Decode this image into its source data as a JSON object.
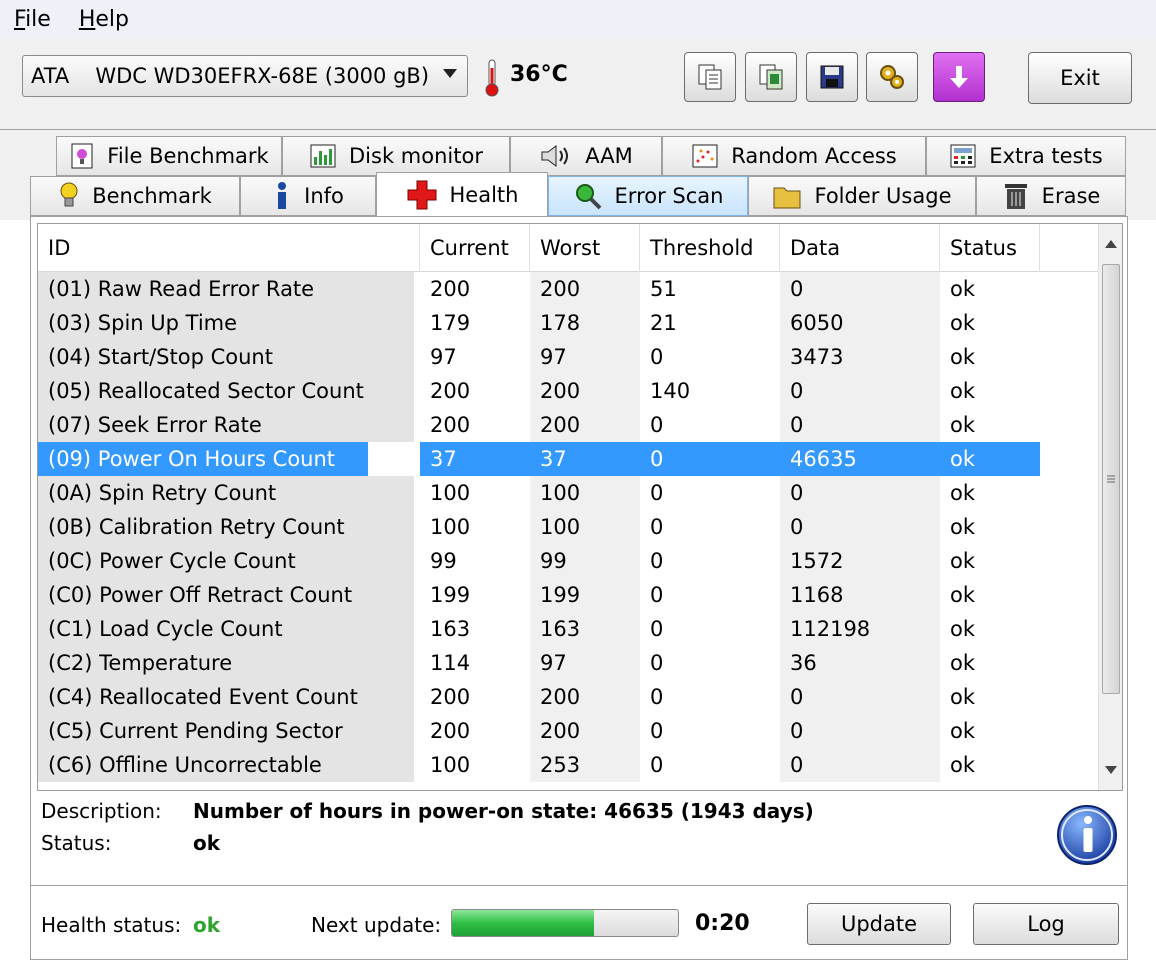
{
  "menu": {
    "file": "File",
    "file_key": "F",
    "file_rest": "ile",
    "help_key": "H",
    "help_rest": "elp"
  },
  "toolbar": {
    "drive_prefix": "ATA",
    "drive_name": "WDC WD30EFRX-68E (3000 gB)",
    "temperature": "36°C",
    "exit_label": "Exit"
  },
  "tabs": {
    "row1": [
      "File Benchmark",
      "Disk monitor",
      "AAM",
      "Random Access",
      "Extra tests"
    ],
    "row2": [
      "Benchmark",
      "Info",
      "Health",
      "Error Scan",
      "Folder Usage",
      "Erase"
    ],
    "active": "Health"
  },
  "table": {
    "headers": [
      "ID",
      "Current",
      "Worst",
      "Threshold",
      "Data",
      "Status"
    ],
    "rows": [
      [
        "(01) Raw Read Error Rate",
        "200",
        "200",
        "51",
        "0",
        "ok"
      ],
      [
        "(03) Spin Up Time",
        "179",
        "178",
        "21",
        "6050",
        "ok"
      ],
      [
        "(04) Start/Stop Count",
        "97",
        "97",
        "0",
        "3473",
        "ok"
      ],
      [
        "(05) Reallocated Sector Count",
        "200",
        "200",
        "140",
        "0",
        "ok"
      ],
      [
        "(07) Seek Error Rate",
        "200",
        "200",
        "0",
        "0",
        "ok"
      ],
      [
        "(09) Power On Hours Count",
        "37",
        "37",
        "0",
        "46635",
        "ok"
      ],
      [
        "(0A) Spin Retry Count",
        "100",
        "100",
        "0",
        "0",
        "ok"
      ],
      [
        "(0B) Calibration Retry Count",
        "100",
        "100",
        "0",
        "0",
        "ok"
      ],
      [
        "(0C) Power Cycle Count",
        "99",
        "99",
        "0",
        "1572",
        "ok"
      ],
      [
        "(C0) Power Off Retract Count",
        "199",
        "199",
        "0",
        "1168",
        "ok"
      ],
      [
        "(C1) Load Cycle Count",
        "163",
        "163",
        "0",
        "112198",
        "ok"
      ],
      [
        "(C2) Temperature",
        "114",
        "97",
        "0",
        "36",
        "ok"
      ],
      [
        "(C4) Reallocated Event Count",
        "200",
        "200",
        "0",
        "0",
        "ok"
      ],
      [
        "(C5) Current Pending Sector",
        "200",
        "200",
        "0",
        "0",
        "ok"
      ],
      [
        "(C6) Offline Uncorrectable",
        "100",
        "253",
        "0",
        "0",
        "ok"
      ]
    ],
    "selected_row": 5
  },
  "details": {
    "description_label": "Description:",
    "description_value": "Number of hours in power-on state: 46635 (1943 days)",
    "status_label": "Status:",
    "status_value": "ok"
  },
  "footer": {
    "health_label": "Health status:",
    "health_value": "ok",
    "next_update_label": "Next update:",
    "progress_fraction": 0.63,
    "timer": "0:20",
    "update_label": "Update",
    "log_label": "Log"
  },
  "colors": {
    "selection": "#3399ff",
    "health_ok": "#2fa52f"
  }
}
